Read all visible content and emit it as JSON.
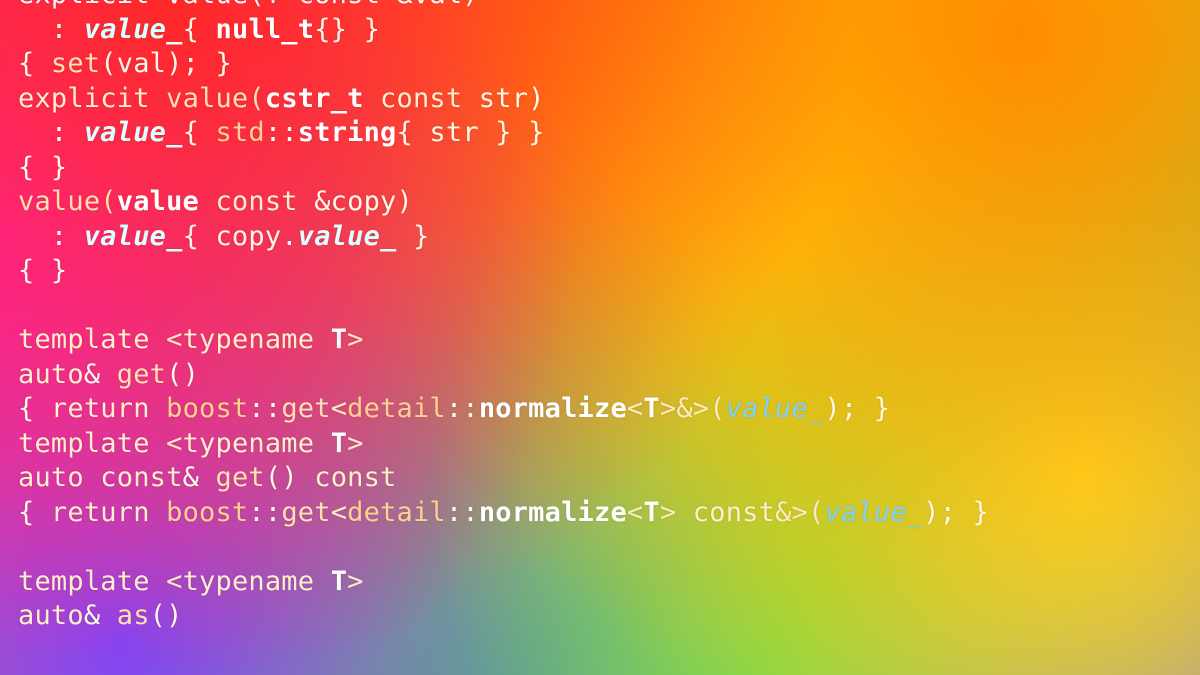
{
  "lines": {
    "l0": "explicit value(T const &val)",
    "l1a": "  : ",
    "l1b": "value_",
    "l1c": "{ ",
    "l1d": "null_t",
    "l1e": "{} }",
    "l2a": "{ ",
    "l2b": "set",
    "l2c": "(val); }",
    "l3a": "explicit",
    "l3b": " value(",
    "l3c": "cstr_t",
    "l3d": " const",
    "l3e": " str)",
    "l4a": "  : ",
    "l4b": "value_",
    "l4c": "{ ",
    "l4d": "std",
    "l4e": "::",
    "l4f": "string",
    "l4g": "{ str } }",
    "l5": "{ }",
    "l6a": "value(",
    "l6b": "value",
    "l6c": " const",
    "l6d": " &copy)",
    "l7a": "  : ",
    "l7b": "value_",
    "l7c": "{ copy.",
    "l7d": "value_",
    "l7e": " }",
    "l8": "{ }",
    "l9": "",
    "l10a": "template",
    "l10b": " <",
    "l10c": "typename",
    "l10d": " ",
    "l10e": "T",
    "l10f": ">",
    "l11a": "auto",
    "l11b": "& ",
    "l11c": "get",
    "l11d": "()",
    "l12a": "{ ",
    "l12b": "return",
    "l12c": " boost",
    "l12d": "::",
    "l12e": "get",
    "l12f": "<",
    "l12g": "detail",
    "l12h": "::",
    "l12i": "normalize",
    "l12j": "<",
    "l12k": "T",
    "l12l": ">&>(",
    "l12m": "value_",
    "l12n": "); }",
    "l13a": "template",
    "l13b": " <",
    "l13c": "typename",
    "l13d": " ",
    "l13e": "T",
    "l13f": ">",
    "l14a": "auto",
    "l14b": " const",
    "l14c": "& ",
    "l14d": "get",
    "l14e": "() ",
    "l14f": "const",
    "l15a": "{ ",
    "l15b": "return",
    "l15c": " boost",
    "l15d": "::",
    "l15e": "get",
    "l15f": "<",
    "l15g": "detail",
    "l15h": "::",
    "l15i": "normalize",
    "l15j": "<",
    "l15k": "T",
    "l15l": "> ",
    "l15m": "const",
    "l15n": "&>(",
    "l15o": "value_",
    "l15p": "); }",
    "l16": "",
    "l17a": "template",
    "l17b": " <",
    "l17c": "typename",
    "l17d": " ",
    "l17e": "T",
    "l17f": ">",
    "l18a": "auto",
    "l18b": "& ",
    "l18c": "as",
    "l18d": "()"
  }
}
